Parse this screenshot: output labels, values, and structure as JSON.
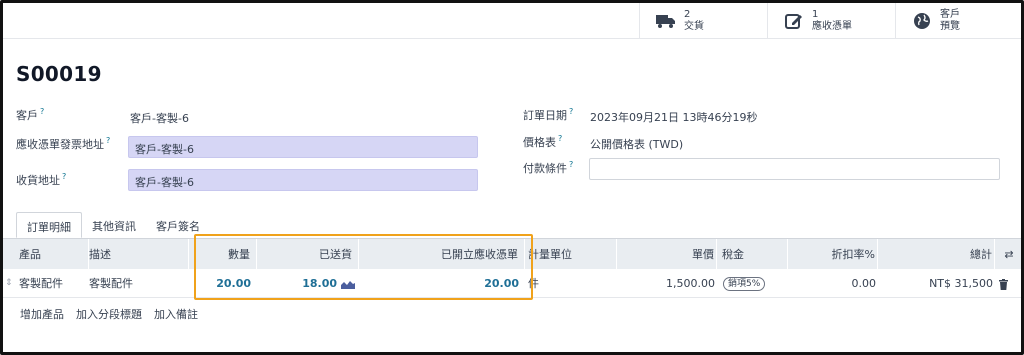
{
  "smart_buttons": [
    {
      "count": "2",
      "label": "交貨",
      "icon": "truck-icon"
    },
    {
      "count": "1",
      "label": "應收憑單",
      "icon": "edit-invoice-icon"
    },
    {
      "count": "",
      "label": "客戶",
      "label2": "預覽",
      "icon": "globe-icon"
    }
  ],
  "order": {
    "title": "S00019",
    "customer_label": "客戶",
    "customer_value": "客戶-客製-6",
    "invoice_addr_label": "應收憑單發票地址",
    "invoice_addr_value": "客戶-客製-6",
    "delivery_addr_label": "收貨地址",
    "delivery_addr_value": "客戶-客製-6",
    "order_date_label": "訂單日期",
    "order_date_value": "2023年09月21日 13時46分19秒",
    "pricelist_label": "價格表",
    "pricelist_value": "公開價格表 (TWD)",
    "payment_terms_label": "付款條件",
    "payment_terms_value": "",
    "help_mark": "?"
  },
  "tabs": [
    "訂單明細",
    "其他資訊",
    "客戶簽名"
  ],
  "table": {
    "columns": [
      "產品",
      "描述",
      "數量",
      "已送貨",
      "已開立應收憑單",
      "計量單位",
      "單價",
      "稅金",
      "折扣率%",
      "總計"
    ],
    "rows": [
      {
        "product": "客製配件",
        "description": "客製配件",
        "quantity": "20.00",
        "delivered": "18.00",
        "invoiced": "20.00",
        "uom": "件",
        "unit_price": "1,500.00",
        "tax": "銷項5%",
        "discount": "0.00",
        "total": "NT$ 31,500"
      }
    ]
  },
  "footer_actions": [
    "增加產品",
    "加入分段標題",
    "加入備註"
  ],
  "colors": {
    "accent": "#f0a21b",
    "field_bg": "#d6d6f5",
    "link": "#1f6f96",
    "header_bg": "#e9edf1"
  }
}
